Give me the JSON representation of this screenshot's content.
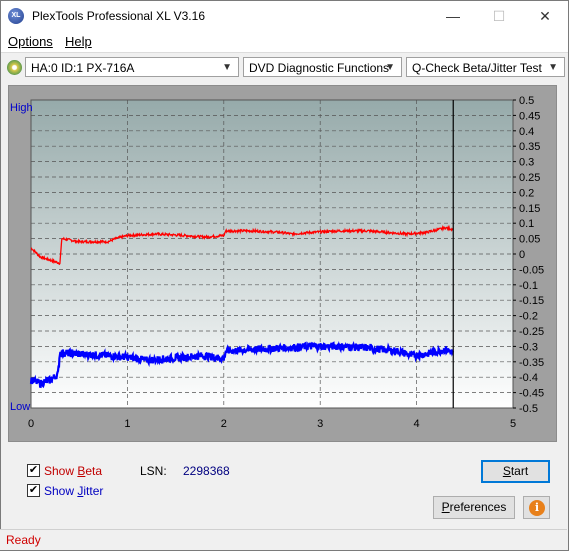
{
  "window": {
    "title": "PlexTools Professional XL V3.16",
    "app_icon_text": "XL",
    "minimize": "—",
    "maximize": "☐",
    "close": "✕"
  },
  "menu": {
    "options": "Options",
    "help": "Help"
  },
  "toolbar": {
    "drive": "HA:0 ID:1  PX-716A",
    "function": "DVD Diagnostic Functions",
    "test": "Q-Check Beta/Jitter Test"
  },
  "chart_data": {
    "type": "line",
    "left_axis_labels": {
      "high": "High",
      "low": "Low"
    },
    "x_ticks": [
      "0",
      "1",
      "2",
      "3",
      "4",
      "5"
    ],
    "x_range": [
      0,
      5
    ],
    "y_right_ticks": [
      "0.5",
      "0.45",
      "0.4",
      "0.35",
      "0.3",
      "0.25",
      "0.2",
      "0.15",
      "0.1",
      "0.05",
      "0",
      "-0.05",
      "-0.1",
      "-0.15",
      "-0.2",
      "-0.25",
      "-0.3",
      "-0.35",
      "-0.4",
      "-0.45",
      "-0.5"
    ],
    "y_range": [
      -0.5,
      0.5
    ],
    "grid": true,
    "end_marker_x": 4.38,
    "series": [
      {
        "key": "beta",
        "color": "#ff0000",
        "x": [
          0.0,
          0.1,
          0.2,
          0.3,
          0.32,
          0.5,
          0.8,
          0.88,
          1.0,
          1.3,
          1.6,
          1.8,
          2.0,
          2.02,
          2.3,
          2.6,
          2.7,
          2.9,
          3.2,
          3.5,
          3.7,
          3.9,
          4.1,
          4.3,
          4.38
        ],
        "y": [
          0.02,
          -0.01,
          -0.02,
          -0.03,
          0.05,
          0.04,
          0.04,
          0.05,
          0.06,
          0.065,
          0.06,
          0.055,
          0.06,
          0.075,
          0.075,
          0.07,
          0.065,
          0.07,
          0.075,
          0.075,
          0.07,
          0.065,
          0.07,
          0.085,
          0.08
        ]
      },
      {
        "key": "jitter",
        "color": "#0000ff",
        "x": [
          0.0,
          0.1,
          0.2,
          0.28,
          0.3,
          0.5,
          0.8,
          1.0,
          1.2,
          1.4,
          1.6,
          1.8,
          2.0,
          2.02,
          2.3,
          2.6,
          2.9,
          3.2,
          3.5,
          3.8,
          3.95,
          4.1,
          4.3,
          4.38
        ],
        "y": [
          -0.41,
          -0.42,
          -0.41,
          -0.39,
          -0.32,
          -0.325,
          -0.33,
          -0.335,
          -0.345,
          -0.34,
          -0.335,
          -0.33,
          -0.34,
          -0.315,
          -0.31,
          -0.305,
          -0.3,
          -0.3,
          -0.305,
          -0.315,
          -0.33,
          -0.325,
          -0.31,
          -0.32
        ]
      }
    ]
  },
  "controls": {
    "show_beta": {
      "pre": "Show ",
      "key": "B",
      "post": "eta",
      "color": "#c00000",
      "checked": true
    },
    "show_jitter": {
      "pre": "Show ",
      "key": "J",
      "post": "itter",
      "color": "#0000c0",
      "checked": true
    },
    "lsn_label": "LSN:",
    "lsn_value": "2298368",
    "start_pre": "",
    "start_key": "S",
    "start_post": "tart",
    "preferences_pre": "",
    "preferences_key": "P",
    "preferences_post": "references",
    "info_icon": "i"
  },
  "status": {
    "text": "Ready"
  }
}
